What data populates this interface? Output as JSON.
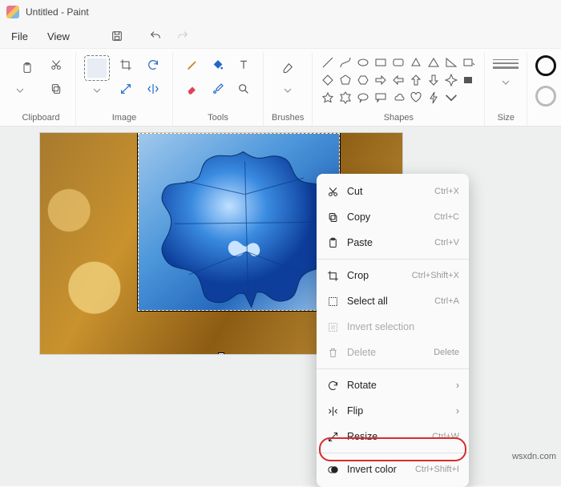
{
  "title": "Untitled - Paint",
  "menubar": {
    "file": "File",
    "view": "View"
  },
  "ribbon": {
    "clipboard": "Clipboard",
    "image": "Image",
    "tools": "Tools",
    "brushes": "Brushes",
    "shapes": "Shapes",
    "size": "Size"
  },
  "context_menu": {
    "cut": {
      "label": "Cut",
      "shortcut": "Ctrl+X"
    },
    "copy": {
      "label": "Copy",
      "shortcut": "Ctrl+C"
    },
    "paste": {
      "label": "Paste",
      "shortcut": "Ctrl+V"
    },
    "crop": {
      "label": "Crop",
      "shortcut": "Ctrl+Shift+X"
    },
    "select_all": {
      "label": "Select all",
      "shortcut": "Ctrl+A"
    },
    "invert_sel": {
      "label": "Invert selection",
      "shortcut": ""
    },
    "delete": {
      "label": "Delete",
      "shortcut": "Delete"
    },
    "rotate": {
      "label": "Rotate",
      "shortcut": ""
    },
    "flip": {
      "label": "Flip",
      "shortcut": ""
    },
    "resize": {
      "label": "Resize",
      "shortcut": "Ctrl+W"
    },
    "invert_color": {
      "label": "Invert color",
      "shortcut": "Ctrl+Shift+I"
    }
  },
  "watermark": "wsxdn.com"
}
